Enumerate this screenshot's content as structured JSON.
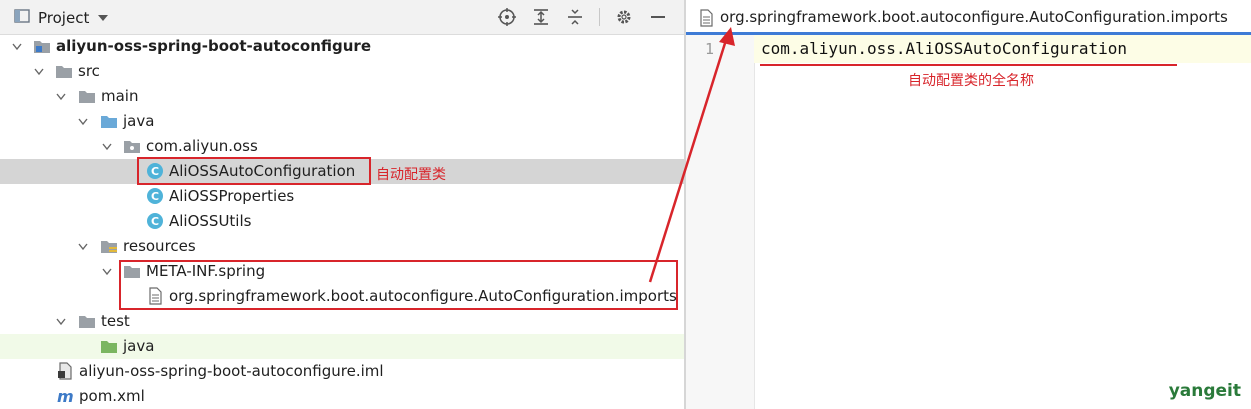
{
  "project_panel": {
    "title": "Project",
    "toolbar_icons": [
      "locate-icon",
      "expand-all-icon",
      "collapse-all-icon",
      "gear-icon",
      "minimize-icon"
    ]
  },
  "tree": {
    "root": "aliyun-oss-spring-boot-autoconfigure",
    "src": "src",
    "main": "main",
    "java": "java",
    "package": "com.aliyun.oss",
    "class_autoconfig": "AliOSSAutoConfiguration",
    "class_properties": "AliOSSProperties",
    "class_utils": "AliOSSUtils",
    "resources": "resources",
    "meta_inf": "META-INF.spring",
    "imports_file": "org.springframework.boot.autoconfigure.AutoConfiguration.imports",
    "test": "test",
    "test_java": "java",
    "iml": "aliyun-oss-spring-boot-autoconfigure.iml",
    "pom": "pom.xml"
  },
  "annotations": {
    "autoconfig_class": "自动配置类",
    "full_name": "自动配置类的全名称"
  },
  "editor": {
    "tab_label": "org.springframework.boot.autoconfigure.AutoConfiguration.imports",
    "line_number": "1",
    "code_line": "com.aliyun.oss.AliOSSAutoConfiguration"
  },
  "watermark": "yangeit",
  "colors": {
    "annotation_red": "#d8252b",
    "selection_gray": "#d5d5d5",
    "test_highlight": "#f1fae8",
    "folder_gray": "#9aa0a6",
    "source_folder_blue": "#6aa9d8",
    "test_folder_green": "#7bb661",
    "class_icon": "#4fb3d9",
    "brand_green": "#2a7a3a"
  }
}
